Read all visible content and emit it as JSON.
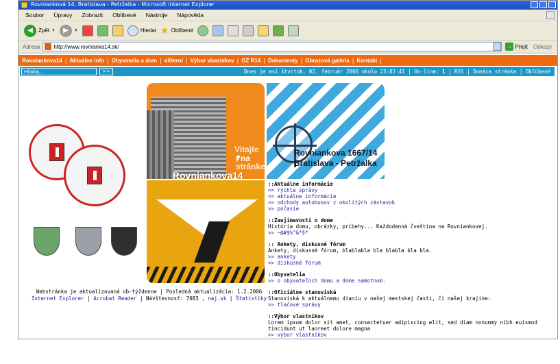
{
  "window": {
    "title": "Rovnianková 14, Bratislava - Petržalka - Microsoft Internet Explorer"
  },
  "menu": [
    "Soubor",
    "Úpravy",
    "Zobrazit",
    "Oblíbené",
    "Nástroje",
    "Nápověda"
  ],
  "toolbar": {
    "back": "Zpět",
    "search": "Hledat",
    "favorites": "Oblíbené"
  },
  "address": {
    "label": "Adresa",
    "url": "http://www.rovnianka14.sk/",
    "go": "Přejít",
    "links": "Odkazy"
  },
  "sitenav": [
    "Rovniankova14",
    "Aktuálne info",
    "Obyvatelia a dom",
    "eXterní",
    "Výbor vlastníkov",
    "OZ R14",
    "Dokumenty",
    "Obrazová galéria",
    "Kontakt"
  ],
  "statbar": {
    "search_placeholder": "Hľadaj...",
    "search_btn": ">>",
    "date_text": "Dnes je asi štvrtok, 02. február 2006 okolo 23:02:41",
    "online_label": "On-line:",
    "online_count": "1",
    "rss": "RSS",
    "home": "Domáca stránka",
    "fav": "Obľúbené"
  },
  "tiles": {
    "welcome_a": "Vitajte",
    "welcome_b": "na",
    "welcome_c": "stránke",
    "welcome_d": "Rovniankova14",
    "addr1": "Rovniankova 1667/14",
    "addr2": "Bratislava - Petržalka"
  },
  "footer": {
    "line1": "Webstránka je aktualizovaná ob-týždenne | Posledná aktualizácia: 1.2.2006",
    "ie": "Internet Explorer",
    "acrobat": "Acrobat Reader",
    "visits": "Návštevnosť: 7083",
    "najsk": "naj.sk",
    "stats": "Štatistiky"
  },
  "info": {
    "s1_title": "::Aktuálne informácie",
    "s1_links": [
      ">> rýchle správy",
      ">> aktuálne informácie",
      ">> odchody autobusov z okolitých zástavok",
      ">> počasie"
    ],
    "s2_title": "::Zaujímavosti o dome",
    "s2_text": "História domu, obrázky, príbehy... Každodenná čveština na Rovniankovej.",
    "s2_link": ">> ~@#$%^&*§*",
    "s3_title": ":: Ankety, diskusné fórum",
    "s3_text": "Ankety, diskusné fórum, blablabla bla blabla bla bla.",
    "s3_links": [
      ">> ankety",
      ">> diskusné fórum"
    ],
    "s4_title": "::Obyvatelia",
    "s4_link": ">> o obyvateľoch domu a dome samotnom.",
    "s5_title": "::Oficiálne stanoviská",
    "s5_text": "Stanoviská k aktuálnemu dianiu v našej mestskej časti, či našej krajine:",
    "s5_link": ">> tlačové správy",
    "s6_title": "::Výbor vlastníkov",
    "s6_text": "Lorem ipsum dolor sit amet, consectetuer adipiscing elit, sed diam nonummy nibh euismod tincidunt ut laoreet dolore magna",
    "s6_link": ">> výbor vlastníkov"
  }
}
